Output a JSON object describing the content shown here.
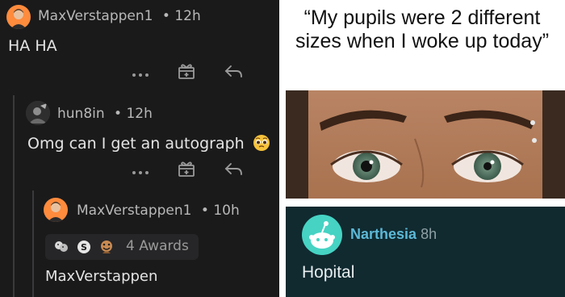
{
  "left_panel": {
    "comments": [
      {
        "username": "MaxVerstappen1",
        "meta": "• 12h",
        "text": "HA HA"
      },
      {
        "username": "hun8in",
        "meta": "• 12h",
        "text": "Omg can I get an autograph",
        "emoji": "pleading-face"
      },
      {
        "username": "MaxVerstappen1",
        "meta": "• 10h",
        "awards_label": "4 Awards",
        "text": "MaxVerstappen"
      }
    ],
    "actions": {
      "more_label": "•••"
    }
  },
  "right_panel": {
    "headline": "“My pupils were 2 different sizes when I woke up today”",
    "reply": {
      "username": "Narthesia",
      "time": "8h",
      "text": "Hopital"
    }
  },
  "colors": {
    "dark_bg": "#1a1a1b",
    "reply_bg": "#102a30",
    "username_accent": "#5cb8d6",
    "avatar_orange": "#ff8b3d",
    "snoo_bg": "#46d3c3"
  }
}
